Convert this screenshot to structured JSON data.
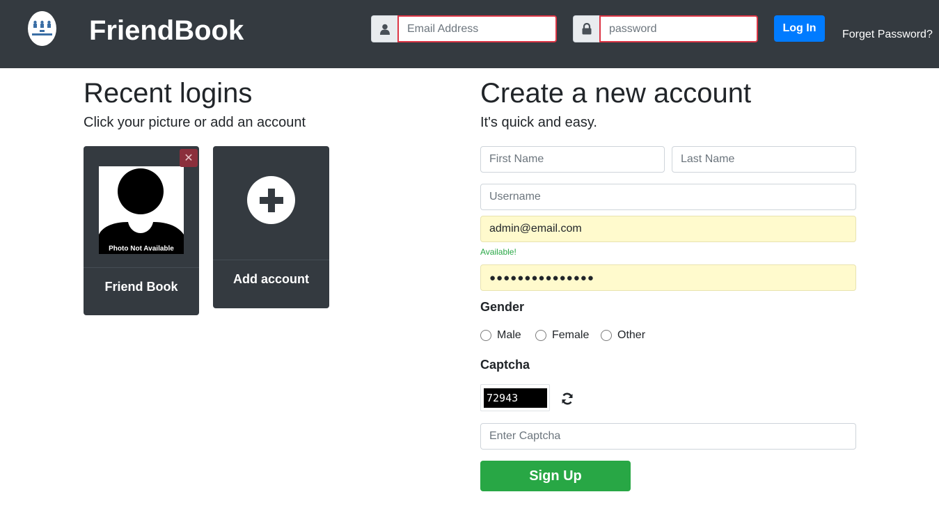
{
  "navbar": {
    "brand": "FriendBook",
    "logo_icon": "friendbook-logo-icon",
    "email_placeholder": "Email Address",
    "password_placeholder": "password",
    "login_label": "Log In",
    "forget_password": "Forget Password?"
  },
  "recent": {
    "title": "Recent logins",
    "subtitle": "Click your picture or add an account",
    "profile": {
      "photo_label": "Photo Not Available",
      "name": "Friend Book",
      "remove_icon": "close-icon"
    },
    "add_label": "Add account"
  },
  "signup": {
    "title": "Create a new account",
    "subtitle": "It's quick and easy.",
    "first_name_placeholder": "First Name",
    "last_name_placeholder": "Last Name",
    "username_placeholder": "Username",
    "email_value": "admin@email.com",
    "email_status": "Available!",
    "password_value": "●●●●●●●●●●●●●●●",
    "gender_label": "Gender",
    "gender_options": [
      "Male",
      "Female",
      "Other"
    ],
    "captcha_label": "Captcha",
    "captcha_code": "72943",
    "captcha_placeholder": "Enter Captcha",
    "signup_label": "Sign Up"
  },
  "colors": {
    "navbar": "#343a40",
    "primary": "#007bff",
    "success": "#28a745",
    "danger": "#dc3545",
    "autofill": "#fffacd"
  }
}
